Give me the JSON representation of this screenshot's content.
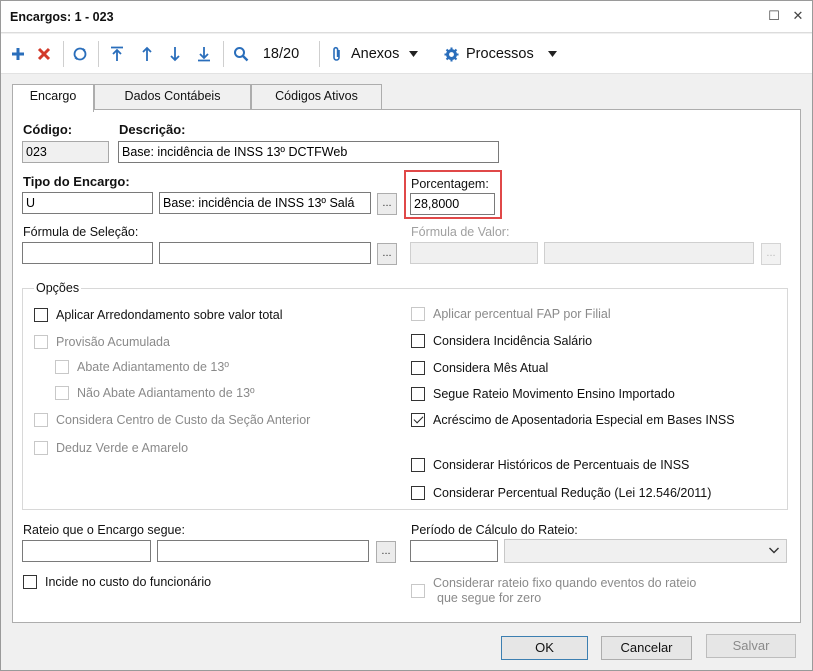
{
  "window": {
    "title": "Encargos: 1 - 023",
    "maximize_glyph": "☐",
    "close_glyph": "✕"
  },
  "toolbar": {
    "record_position": "18/20",
    "anexos_label": "Anexos",
    "processos_label": "Processos",
    "icons": [
      "plus-icon",
      "delete-icon",
      "refresh-icon",
      "first-icon",
      "previous-icon",
      "next-icon",
      "last-icon",
      "search-icon",
      "paperclip-icon",
      "gear-icon"
    ],
    "colors": {
      "accent": "#2a6ebb",
      "delete": "#d23a2a"
    }
  },
  "tabs": [
    {
      "label": "Encargo",
      "active": true
    },
    {
      "label": "Dados Contábeis",
      "active": false
    },
    {
      "label": "Códigos Ativos",
      "active": false
    }
  ],
  "form": {
    "codigo": {
      "label": "Código:",
      "value": "023"
    },
    "descricao": {
      "label": "Descrição:",
      "value": "Base: incidência de INSS 13º DCTFWeb"
    },
    "tipo_encargo": {
      "label": "Tipo do Encargo:",
      "code": "U",
      "description": "Base: incidência de INSS 13º Salá"
    },
    "porcentagem": {
      "label": "Porcentagem:",
      "value": "28,8000"
    },
    "formula_selecao": {
      "label": "Fórmula de Seleção:",
      "code": "",
      "description": ""
    },
    "formula_valor": {
      "label": "Fórmula de Valor:",
      "code": "",
      "description": ""
    },
    "ellipsis": "..."
  },
  "options": {
    "title": "Opções",
    "left": [
      {
        "label": "Aplicar Arredondamento sobre valor total",
        "checked": false,
        "enabled": true
      },
      {
        "label": "Provisão Acumulada",
        "checked": false,
        "enabled": false
      },
      {
        "label": "Abate Adiantamento de 13º",
        "checked": false,
        "enabled": false
      },
      {
        "label": "Não Abate Adiantamento de 13º",
        "checked": false,
        "enabled": false
      },
      {
        "label": "Considera Centro de Custo da Seção Anterior",
        "checked": false,
        "enabled": false
      },
      {
        "label": "Deduz Verde e Amarelo",
        "checked": false,
        "enabled": false
      }
    ],
    "right": [
      {
        "label": "Aplicar percentual FAP por Filial",
        "checked": false,
        "enabled": false
      },
      {
        "label": "Considera Incidência Salário",
        "checked": false,
        "enabled": true
      },
      {
        "label": "Considera Mês Atual",
        "checked": false,
        "enabled": true
      },
      {
        "label": "Segue Rateio Movimento Ensino Importado",
        "checked": false,
        "enabled": true
      },
      {
        "label": "Acréscimo de Aposentadoria Especial em Bases INSS",
        "checked": true,
        "enabled": true
      },
      {
        "label": "Considerar Históricos de Percentuais de INSS",
        "checked": false,
        "enabled": true
      },
      {
        "label": "Considerar Percentual Redução (Lei 12.546/2011)",
        "checked": false,
        "enabled": true
      }
    ]
  },
  "rateio": {
    "label": "Rateio que o Encargo segue:",
    "code": "",
    "description": "",
    "incide_label": "Incide no custo do funcionário",
    "periodo_label": "Período de Cálculo do Rateio:",
    "periodo_value": "",
    "periodo_select": "",
    "fixo_line1": "Considerar rateio fixo quando eventos do rateio",
    "fixo_line2": "que segue for zero"
  },
  "buttons": {
    "ok": "OK",
    "cancelar": "Cancelar",
    "salvar": "Salvar"
  }
}
